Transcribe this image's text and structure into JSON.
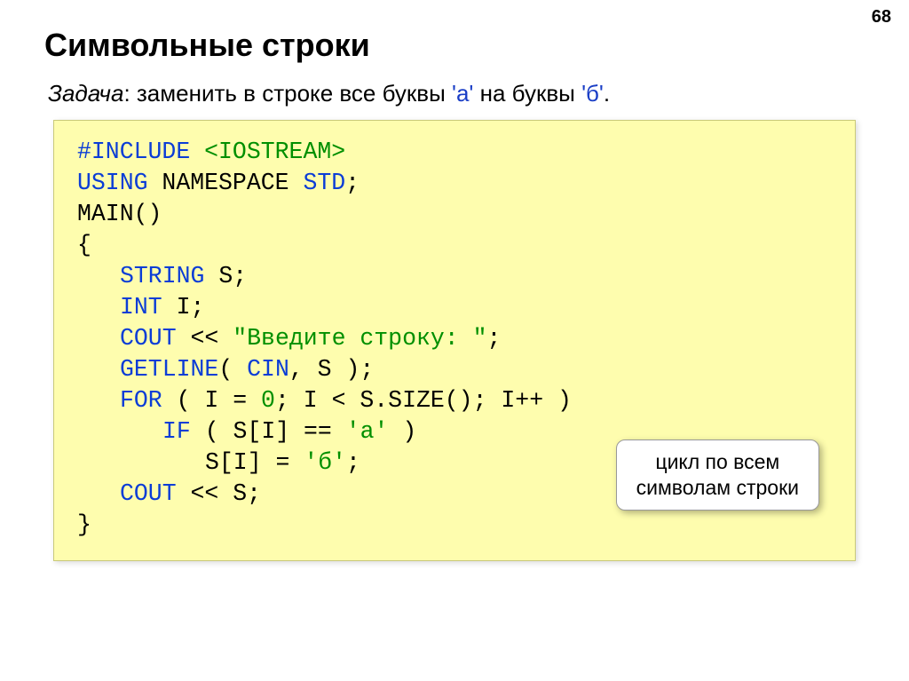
{
  "page_number": "68",
  "title": "Символьные строки",
  "task": {
    "label": "Задача",
    "text": ": заменить в строке все буквы ",
    "char_a": "'а'",
    "middle": " на буквы ",
    "char_b": "'б'",
    "end": "."
  },
  "code": {
    "l1a": "#INCLUDE ",
    "l1b": "<IOSTREAM>",
    "l2a": "USING",
    "l2b": " NAMESPACE ",
    "l2c": "STD",
    "l2d": ";",
    "l3": "MAIN()",
    "l4": "{",
    "l5a": "STRING",
    "l5b": " S;",
    "l6a": "INT",
    "l6b": " I;",
    "l7a": "COUT",
    "l7b": " << ",
    "l7c": "\"Введите строку: \"",
    "l7d": ";",
    "l8a": "GETLINE",
    "l8b": "( ",
    "l8c": "CIN",
    "l8d": ", S );",
    "l9a": "FOR",
    "l9b": " ( I = ",
    "l9c": "0",
    "l9d": "; I < S.SIZE(); I++ )",
    "l10a": "IF",
    "l10b": " ( S[I] == ",
    "l10c": "'а'",
    "l10d": " )",
    "l11a": "S[I] = ",
    "l11b": "'б'",
    "l11c": ";",
    "l12a": "COUT",
    "l12b": " << S;",
    "l13": "}"
  },
  "callout": {
    "line1": "цикл по всем",
    "line2": "символам строки"
  }
}
